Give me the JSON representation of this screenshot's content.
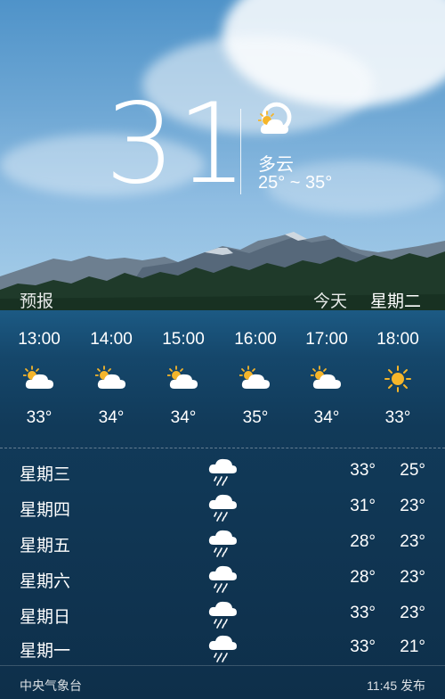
{
  "current": {
    "temperature": "31°",
    "condition": "多云",
    "range": "25° ~ 35°",
    "icon": "partly-cloudy-icon"
  },
  "labels": {
    "forecast": "预报",
    "today": "今天",
    "weekday": "星期二"
  },
  "hourly": [
    {
      "time": "13:00",
      "icon": "partly-cloudy-icon",
      "temp": "33°"
    },
    {
      "time": "14:00",
      "icon": "partly-cloudy-icon",
      "temp": "34°"
    },
    {
      "time": "15:00",
      "icon": "partly-cloudy-icon",
      "temp": "34°"
    },
    {
      "time": "16:00",
      "icon": "partly-cloudy-icon",
      "temp": "35°"
    },
    {
      "time": "17:00",
      "icon": "partly-cloudy-icon",
      "temp": "34°"
    },
    {
      "time": "18:00",
      "icon": "sun-icon",
      "temp": "33°"
    }
  ],
  "daily": [
    {
      "day": "星期三",
      "icon": "rain-icon",
      "high": "33°",
      "low": "25°"
    },
    {
      "day": "星期四",
      "icon": "rain-icon",
      "high": "31°",
      "low": "23°"
    },
    {
      "day": "星期五",
      "icon": "rain-icon",
      "high": "28°",
      "low": "23°"
    },
    {
      "day": "星期六",
      "icon": "rain-icon",
      "high": "28°",
      "low": "23°"
    },
    {
      "day": "星期日",
      "icon": "rain-icon",
      "high": "33°",
      "low": "23°"
    },
    {
      "day": "星期一",
      "icon": "rain-icon",
      "high": "33°",
      "low": "21°"
    }
  ],
  "footer": {
    "source": "中央气象台",
    "published": "11:45 发布"
  },
  "colors": {
    "sun": "#f5b52a",
    "cloud": "#ffffff",
    "rain": "#ffffff",
    "water_dark": "#0e2f4a"
  }
}
